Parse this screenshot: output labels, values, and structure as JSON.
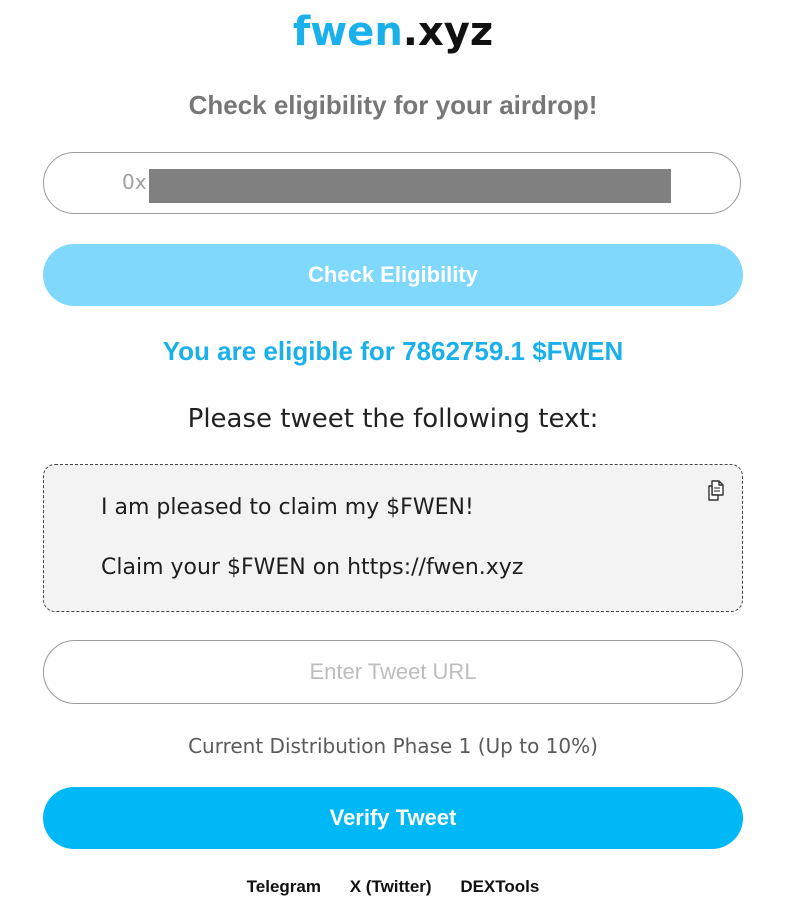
{
  "header": {
    "logo_part_a": "fwen",
    "logo_part_b": ".xyz",
    "subtitle": "Check eligibility for your airdrop!"
  },
  "wallet": {
    "visible_value": "0x",
    "redacted": true
  },
  "check_button": {
    "label": "Check Eligibility"
  },
  "result": {
    "eligible_text": "You are eligible for 7862759.1 $FWEN"
  },
  "tweet": {
    "prompt": "Please tweet the following text:",
    "line1": "I am pleased to claim my $FWEN!",
    "line2": "Claim your $FWEN on https://fwen.xyz",
    "copy_icon": "copy-icon"
  },
  "tweet_url_input": {
    "placeholder": "Enter Tweet URL",
    "value": ""
  },
  "phase_text": "Current Distribution Phase 1 (Up to 10%)",
  "verify_button": {
    "label": "Verify Tweet"
  },
  "footer": {
    "links": [
      "Telegram",
      "X (Twitter)",
      "DEXTools"
    ]
  },
  "colors": {
    "brand": "#1ab0ec",
    "check_button_bg": "#80d9fc",
    "verify_button_bg": "#00b8f5",
    "tweet_box_bg": "#f3f3f3",
    "redaction": "#808080"
  }
}
